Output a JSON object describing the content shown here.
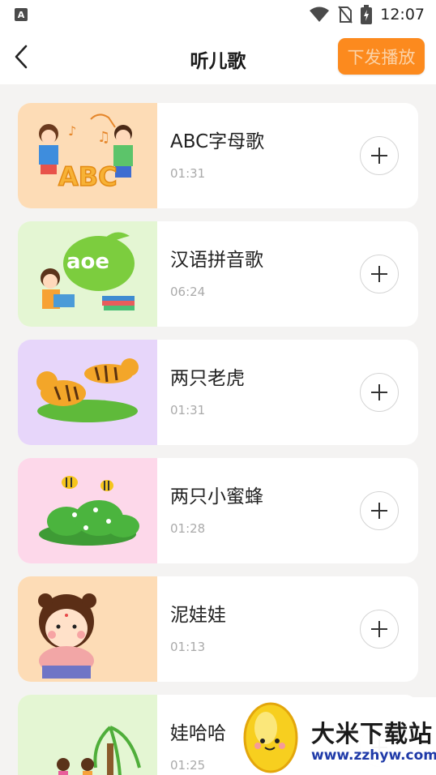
{
  "status_bar": {
    "left_icon": "A",
    "time": "12:07",
    "icons": [
      "wifi-icon",
      "no-sim-icon",
      "battery-charging-icon"
    ]
  },
  "header": {
    "back_icon": "chevron-left-icon",
    "title": "听儿歌",
    "play_button": "下发播放"
  },
  "songs": [
    {
      "title": "ABC字母歌",
      "duration": "01:31",
      "thumb_bg": "#fddcb6",
      "art": "abc-kids"
    },
    {
      "title": "汉语拼音歌",
      "duration": "06:24",
      "thumb_bg": "#e4f6d3",
      "art": "aoe-girl"
    },
    {
      "title": "两只老虎",
      "duration": "01:31",
      "thumb_bg": "#e7d6fa",
      "art": "tigers"
    },
    {
      "title": "两只小蜜蜂",
      "duration": "01:28",
      "thumb_bg": "#fdd8ea",
      "art": "bees"
    },
    {
      "title": "泥娃娃",
      "duration": "01:13",
      "thumb_bg": "#fddcb6",
      "art": "doll"
    },
    {
      "title": "娃哈哈",
      "duration": "01:25",
      "thumb_bg": "#e4f6d3",
      "art": "kids-tree"
    }
  ],
  "watermark": {
    "name": "大米下载站",
    "url": "www.zzhyw.com"
  },
  "colors": {
    "accent": "#fc8a1e",
    "background": "#f4f3f2"
  }
}
